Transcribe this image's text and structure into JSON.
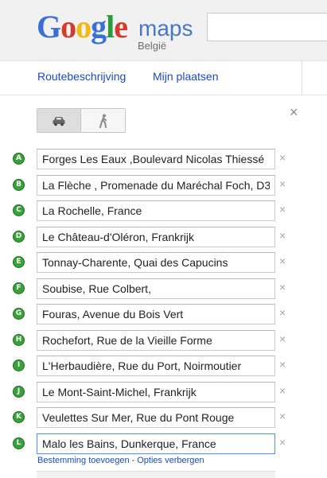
{
  "header": {
    "logo": {
      "letters": [
        "G",
        "o",
        "o",
        "g",
        "l",
        "e"
      ],
      "colors": [
        "#3b6fd8",
        "#d23b2e",
        "#f2b90f",
        "#3b6fd8",
        "#2d9a3c",
        "#d23b2e"
      ],
      "product": "maps",
      "country": "België"
    },
    "search": {
      "value": ""
    }
  },
  "nav": {
    "directions": "Routebeschrijving",
    "my_places": "Mijn plaatsen"
  },
  "mode": {
    "selected": "car",
    "car_icon": "car-icon",
    "walk_icon": "walk-icon"
  },
  "panel": {
    "close_label": "×"
  },
  "waypoints": [
    {
      "marker": "A",
      "value": "Forges Les Eaux ,Boulevard Nicolas Thiessé"
    },
    {
      "marker": "B",
      "value": "La Flèche , Promenade du Maréchal Foch, D3"
    },
    {
      "marker": "C",
      "value": "La Rochelle, France"
    },
    {
      "marker": "D",
      "value": "Le Château-d'Oléron, Frankrijk"
    },
    {
      "marker": "E",
      "value": "Tonnay-Charente, Quai des Capucins"
    },
    {
      "marker": "F",
      "value": "Soubise, Rue Colbert,"
    },
    {
      "marker": "G",
      "value": "Fouras, Avenue du Bois Vert"
    },
    {
      "marker": "H",
      "value": "Rochefort, Rue de la Vieille Forme"
    },
    {
      "marker": "I",
      "value": "L'Herbaudière, Rue du Port, Noirmoutier"
    },
    {
      "marker": "J",
      "value": "Le Mont-Saint-Michel, Frankrijk"
    },
    {
      "marker": "K",
      "value": "Veulettes Sur Mer, Rue du Pont Rouge"
    },
    {
      "marker": "L",
      "value": "Malo les Bains, Dunkerque, France"
    }
  ],
  "remove_label": "×",
  "bottom_links": {
    "add_destination": "Bestemming toevoegen",
    "separator": "-",
    "hide_options": "Opties verbergen"
  },
  "colors": {
    "marker_green": "#38a13a",
    "link_blue": "#1b49c4",
    "maps_blue": "#4778c4"
  }
}
